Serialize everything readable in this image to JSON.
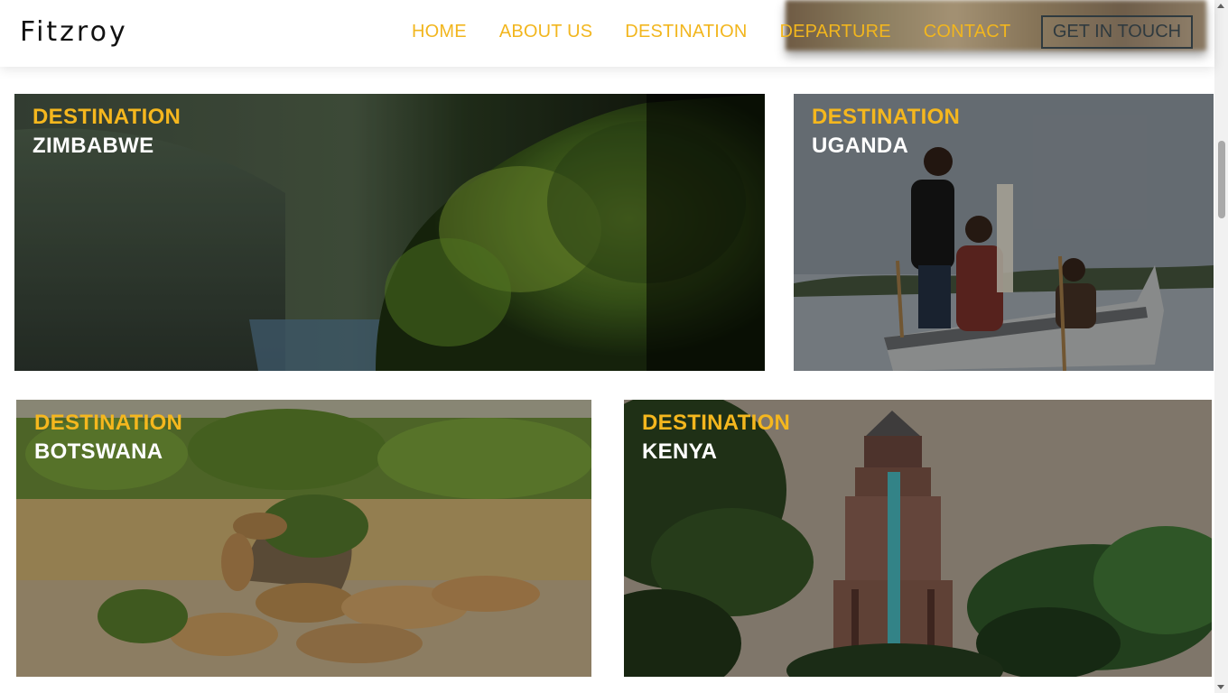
{
  "header": {
    "brand": "Fitzroy",
    "nav": [
      "HOME",
      "ABOUT US",
      "DESTINATION",
      "DEPARTURE",
      "CONTACT"
    ],
    "cta_label": "GET IN TOUCH"
  },
  "cards": [
    {
      "kicker": "DESTINATION",
      "name": "ZIMBABWE"
    },
    {
      "kicker": "DESTINATION",
      "name": "UGANDA"
    },
    {
      "kicker": "DESTINATION",
      "name": "BOTSWANA"
    },
    {
      "kicker": "DESTINATION",
      "name": "KENYA"
    }
  ],
  "colors": {
    "accent": "#f5b71e",
    "card_label": "#ffffff",
    "cta_border": "#2f3a3f"
  }
}
